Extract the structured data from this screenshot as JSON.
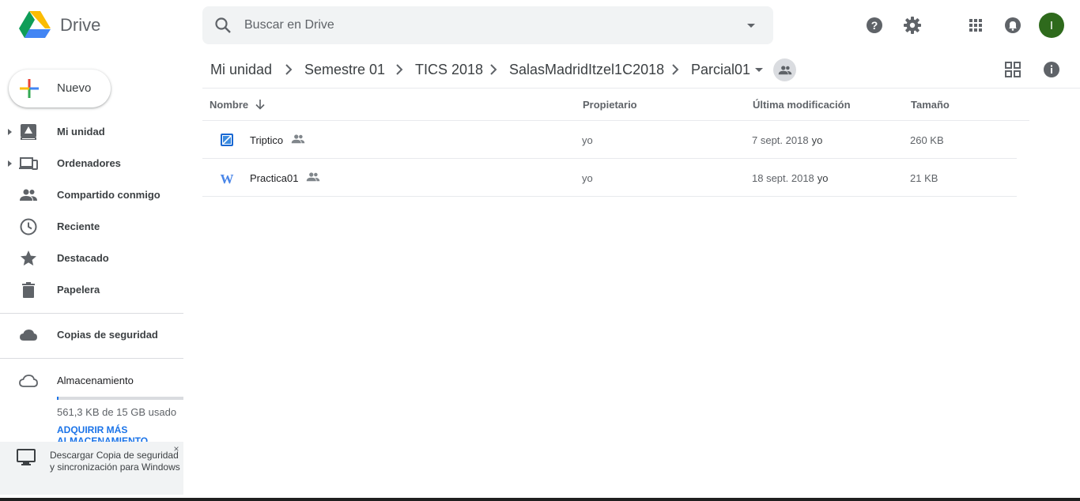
{
  "app": {
    "title": "Drive"
  },
  "search": {
    "placeholder": "Buscar en Drive",
    "value": ""
  },
  "header": {
    "icons": [
      "help-icon",
      "settings-icon",
      "apps-icon",
      "notifications-icon"
    ],
    "avatar_initial": "I",
    "avatar_color": "#2e6a1c"
  },
  "sidebar": {
    "new_label": "Nuevo",
    "items": [
      {
        "label": "Mi unidad",
        "icon": "drive-icon",
        "expandable": true
      },
      {
        "label": "Ordenadores",
        "icon": "computers-icon",
        "expandable": true
      },
      {
        "label": "Compartido conmigo",
        "icon": "shared-people-icon",
        "expandable": false
      },
      {
        "label": "Reciente",
        "icon": "clock-icon",
        "expandable": false
      },
      {
        "label": "Destacado",
        "icon": "star-icon",
        "expandable": false
      },
      {
        "label": "Papelera",
        "icon": "trash-icon",
        "expandable": false
      },
      {
        "label": "Copias de seguridad",
        "icon": "cloud-icon",
        "expandable": false
      },
      {
        "label": "Almacenamiento",
        "icon": "cloud-outline-icon",
        "expandable": false
      }
    ],
    "storage": {
      "used_text": "561,3 KB de 15 GB usado",
      "used_fraction": 4e-05,
      "buy_more": "ADQUIRIR MÁS ALMACENAMIENTO"
    },
    "promo": {
      "text": "Descargar Copia de seguridad y sincronización para Windows",
      "close": "×"
    }
  },
  "breadcrumb": [
    "Mi unidad",
    "Semestre 01",
    "TICS 2018",
    "SalasMadridItzel1C2018",
    "Parcial01"
  ],
  "table": {
    "columns": {
      "name": "Nombre",
      "owner": "Propietario",
      "modified": "Última modificación",
      "size": "Tamaño"
    },
    "rows": [
      {
        "name": "Triptico",
        "type": "publisher-file-icon",
        "shared": true,
        "owner": "yo",
        "modified": "7 sept. 2018",
        "modified_by": "yo",
        "size": "260 KB"
      },
      {
        "name": "Practica01",
        "type": "word-file-icon",
        "shared": true,
        "owner": "yo",
        "modified": "18 sept. 2018",
        "modified_by": "yo",
        "size": "21 KB"
      }
    ]
  },
  "colors": {
    "accent": "#1a73e8",
    "text": "#3c4043",
    "muted": "#5f6368"
  }
}
